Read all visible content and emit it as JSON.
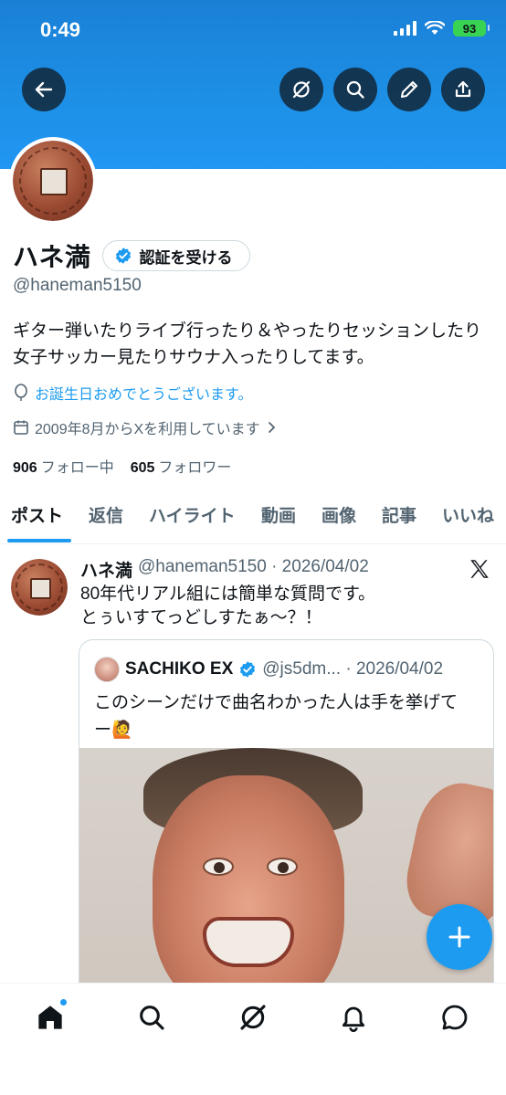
{
  "status_bar": {
    "time": "0:49",
    "battery": "93"
  },
  "header": {
    "icons": [
      "back-arrow-icon",
      "grok-icon",
      "search-icon",
      "edit-icon",
      "share-icon"
    ]
  },
  "profile": {
    "display_name": "ハネ満",
    "verify_label": "認証を受ける",
    "handle": "@haneman5150",
    "bio_line1": "ギター弾いたりライブ行ったり＆やったりセッションしたり",
    "bio_line2": "女子サッカー見たりサウナ入ったりしてます。",
    "birthday": "お誕生日おめでとうございます。",
    "joined": "2009年8月からXを利用しています",
    "following_count": "906",
    "following_label": "フォロー中",
    "followers_count": "605",
    "followers_label": "フォロワー"
  },
  "tabs": [
    "ポスト",
    "返信",
    "ハイライト",
    "動画",
    "画像",
    "記事",
    "いいね"
  ],
  "active_tab": "ポスト",
  "post": {
    "author": "ハネ満",
    "meta": "@haneman5150 · 2026/04/02",
    "line1": "80年代リアル組には簡単な質問です。",
    "line2": "とぅいすてっどしすたぁ〜？！",
    "quote": {
      "author": "SACHIKO EX",
      "meta": "@js5dm... · 2026/04/02",
      "line1": "このシーンだけで曲名わかった人は手を挙げて",
      "line2": "ー🙋"
    }
  },
  "bottom_nav": [
    "home-icon",
    "search-icon",
    "grok-icon",
    "notifications-icon",
    "messages-icon"
  ],
  "colors": {
    "accent": "#1d9bf0",
    "banner": "#1d90e6",
    "text_primary": "#0f1419",
    "text_secondary": "#536471"
  }
}
